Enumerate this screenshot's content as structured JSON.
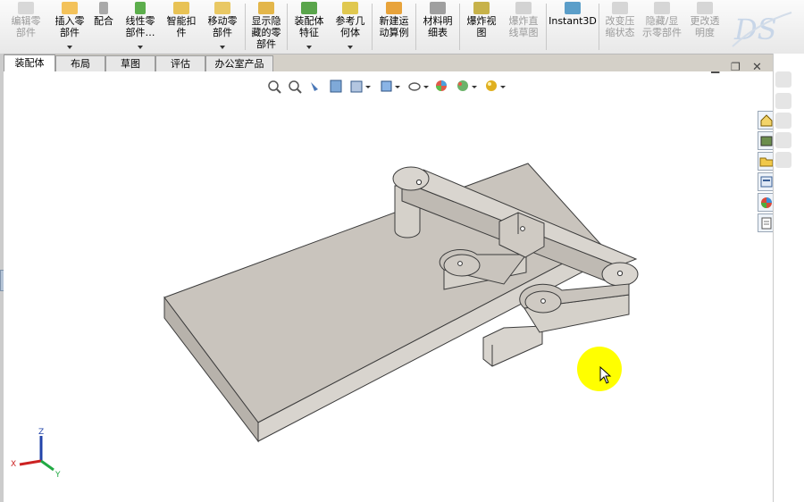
{
  "toolbar": {
    "edit_part": "编辑零部件",
    "insert_components": "插入零部件",
    "mate": "配合",
    "linear_pattern": "线性零部件…",
    "smart_fasteners": "智能扣件",
    "move_component": "移动零部件",
    "show_hidden": "显示隐藏的零部件",
    "assembly_features": "装配体特征",
    "reference_geometry": "参考几何体",
    "new_motion_study": "新建运动算例",
    "bom": "材料明细表",
    "exploded_view": "爆炸视图",
    "explode_line_sketch": "爆炸直线草图",
    "instant3d": "Instant3D",
    "change_suppression": "改变压缩状态",
    "hide_show_components": "隐藏/显示零部件",
    "change_transparency": "更改透明度"
  },
  "tabs": [
    "装配体",
    "布局",
    "草图",
    "评估",
    "办公室产品"
  ],
  "triad": {
    "x_label": "X",
    "y_label": "Y",
    "z_label": "Z"
  },
  "colors": {
    "part_face": "#c8c3bc",
    "part_dark": "#8f8a83",
    "highlight": "#ffff00",
    "logo": "#c8d6e8"
  },
  "icons": {
    "heads_up": [
      "zoom-to-fit-icon",
      "zoom-area-icon",
      "previous-view-icon",
      "section-view-icon",
      "view-orientation-icon",
      "display-style-icon",
      "hide-show-icon",
      "appearance-icon",
      "scene-icon",
      "render-icon"
    ],
    "taskpane": [
      "home-icon",
      "design-library-icon",
      "file-explorer-icon",
      "view-palette-icon",
      "appearances-icon",
      "custom-properties-icon"
    ]
  }
}
